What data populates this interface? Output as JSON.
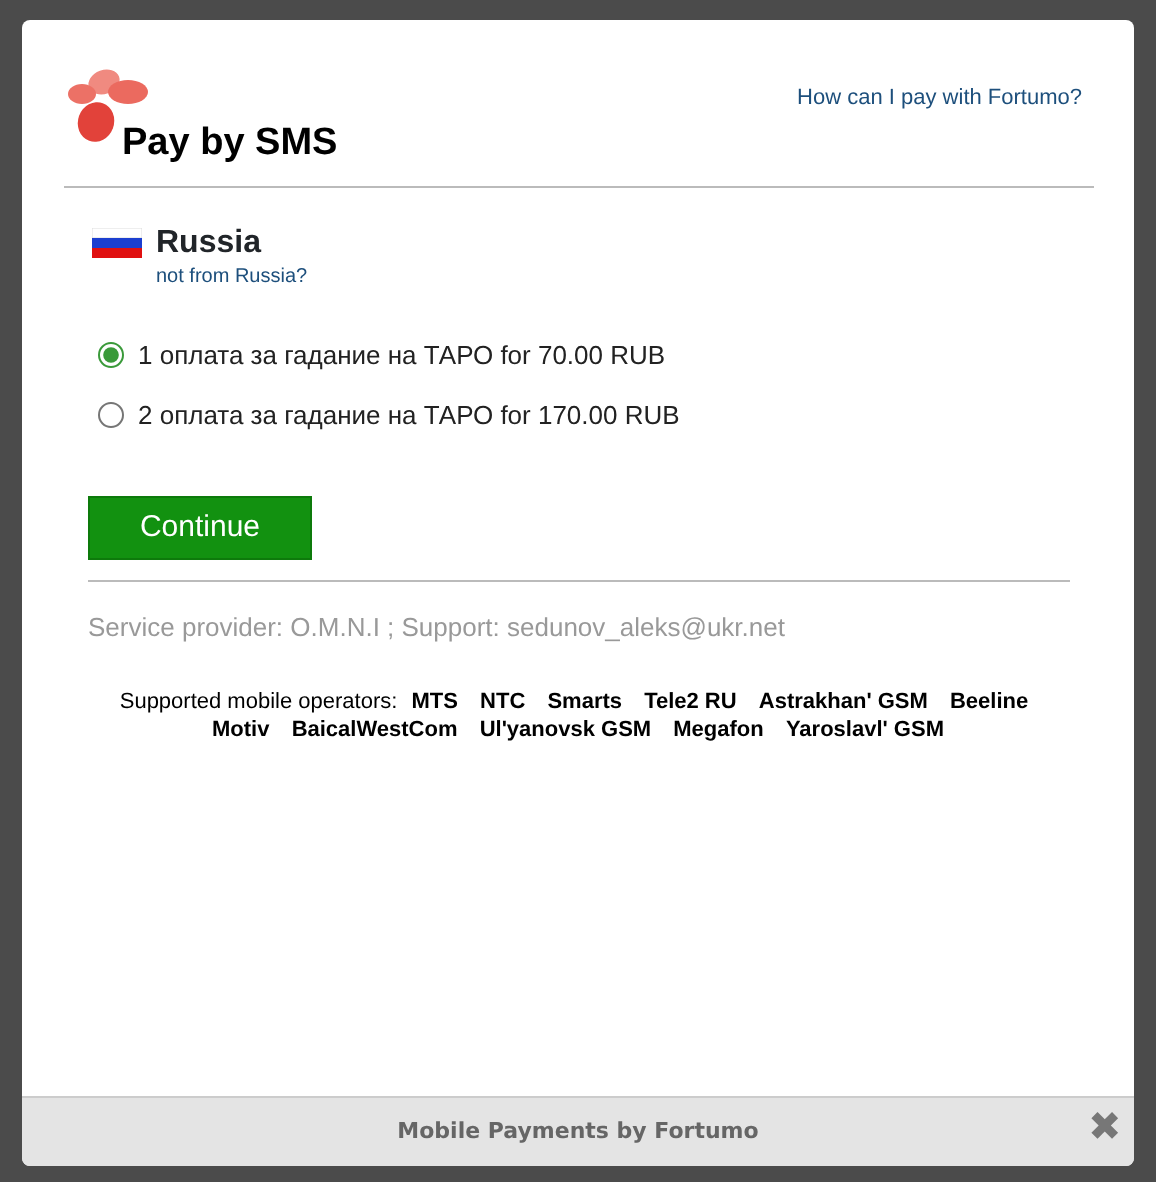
{
  "help_link": "How can I pay with Fortumo?",
  "title": "Pay by SMS",
  "country": {
    "name": "Russia",
    "change_link": "not from Russia?"
  },
  "options": [
    {
      "label": "1 оплата за гадание на ТАРО for 70.00 RUB",
      "selected": true
    },
    {
      "label": "2 оплата за гадание на ТАРО for 170.00 RUB",
      "selected": false
    }
  ],
  "continue_button": "Continue",
  "provider_info": "Service provider: O.M.N.I ; Support: sedunov_aleks@ukr.net",
  "operators_label": "Supported mobile operators:",
  "operators": [
    "MTS",
    "NTC",
    "Smarts",
    "Tele2 RU",
    "Astrakhan' GSM",
    "Beeline",
    "Motiv",
    "BaicalWestCom",
    "Ul'yanovsk GSM",
    "Megafon",
    "Yaroslavl' GSM"
  ],
  "footer": {
    "text": "Mobile Payments by Fortumo",
    "close": "✖"
  }
}
